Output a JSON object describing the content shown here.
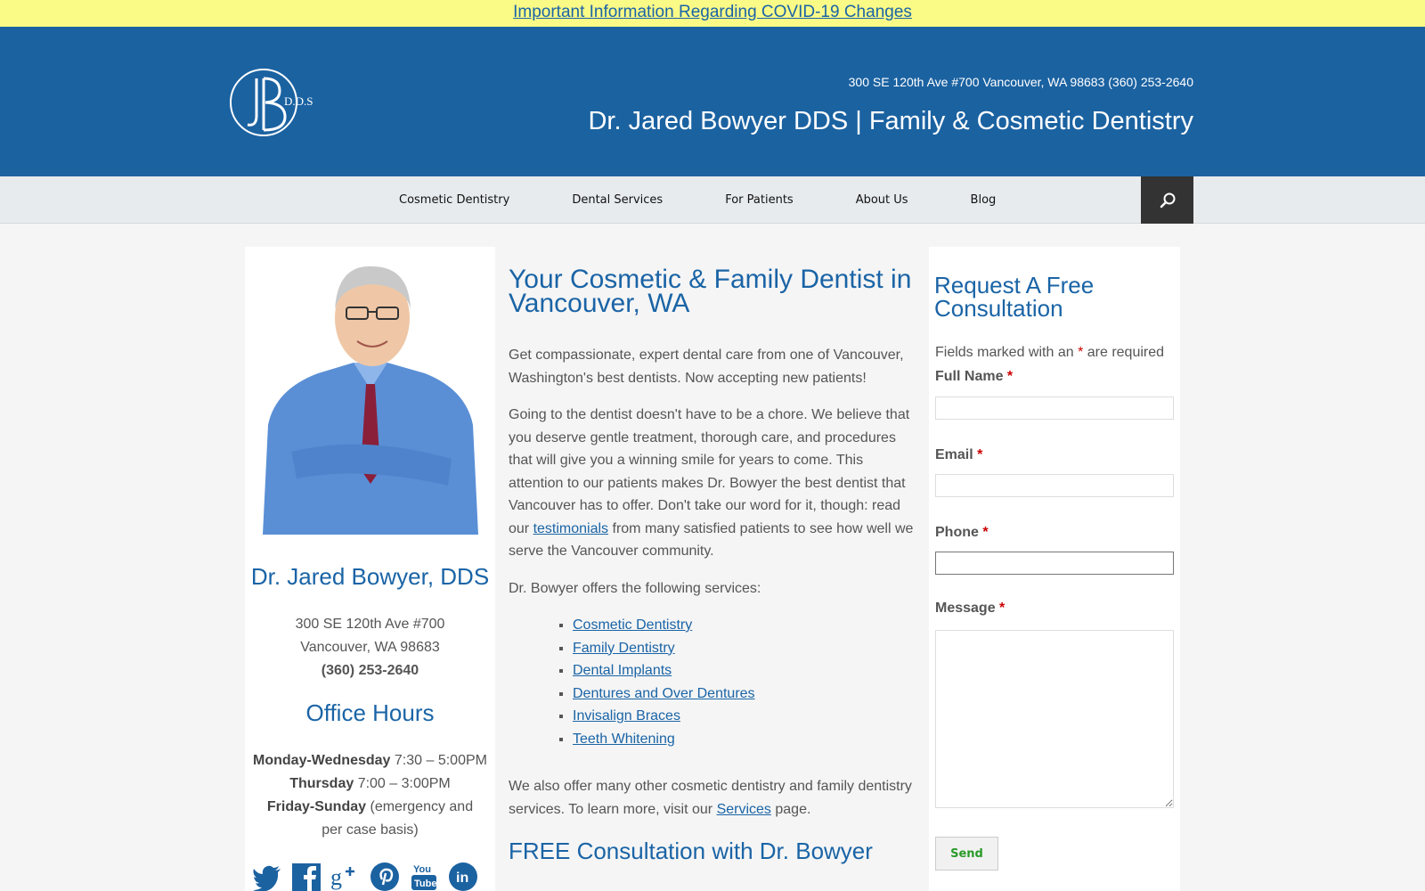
{
  "banner": {
    "text": "Important Information Regarding COVID-19 Changes"
  },
  "header": {
    "address_phone": "300 SE 120th Ave #700 Vancouver, WA 98683 (360) 253-2640",
    "site_title": "Dr. Jared Bowyer DDS | Family & Cosmetic Dentistry",
    "logo_text": "D.D.S"
  },
  "nav": {
    "items": [
      {
        "label": "Cosmetic Dentistry"
      },
      {
        "label": "Dental Services"
      },
      {
        "label": "For Patients"
      },
      {
        "label": "About Us"
      },
      {
        "label": "Blog"
      }
    ],
    "search_icon": "search-icon"
  },
  "sidebar": {
    "doctor_name": "Dr. Jared Bowyer, DDS",
    "address_line1": "300 SE 120th Ave #700",
    "address_line2": "Vancouver, WA 98683",
    "phone": "(360) 253-2640",
    "hours_title": "Office Hours",
    "hours": [
      {
        "day": "Monday-Wednesday",
        "time": "7:30 – 5:00PM"
      },
      {
        "day": "Thursday",
        "time": "7:00 – 3:00PM"
      },
      {
        "day": "Friday-Sunday",
        "time": "(emergency and per case basis)"
      }
    ],
    "social": [
      "twitter-icon",
      "facebook-icon",
      "google-plus-icon",
      "pinterest-icon",
      "youtube-icon",
      "linkedin-icon"
    ],
    "youtube_text_top": "You",
    "youtube_text_bottom": "Tube",
    "linkedin_text": "in"
  },
  "main": {
    "heading": "Your Cosmetic & Family Dentist in Vancouver, WA",
    "intro": "Get compassionate, expert dental care from one of Vancouver, Washington's best dentists. Now accepting new patients!",
    "para2_before": "Going to the dentist doesn't have to be a chore. We believe that you deserve gentle treatment, thorough care, and procedures that will give you a winning smile for years to come. This attention to our patients makes Dr. Bowyer the best dentist that Vancouver has to offer. Don't take our word for it, though: read our ",
    "para2_link": "testimonials",
    "para2_after": " from many satisfied patients to see how well we serve the Vancouver community.",
    "services_intro": "Dr. Bowyer offers the following services:",
    "services": [
      "Cosmetic Dentistry",
      "Family Dentistry",
      "Dental Implants",
      "Dentures and Over Dentures",
      "Invisalign Braces",
      "Teeth Whitening"
    ],
    "outro_before": "We also offer many other cosmetic dentistry and family dentistry services. To learn more, visit our ",
    "outro_link": "Services",
    "outro_after": " page.",
    "subheading": "FREE Consultation with Dr. Bowyer"
  },
  "form": {
    "title": "Request A Free Consultation",
    "required_note_before": "Fields marked with an ",
    "required_star": "*",
    "required_note_after": " are required",
    "full_name_label": "Full Name",
    "email_label": "Email",
    "phone_label": "Phone",
    "message_label": "Message",
    "send_label": "Send"
  },
  "colors": {
    "brand_blue": "#1b62a1",
    "link_blue": "#1a64a6",
    "banner_yellow": "#fafa87",
    "required_red": "#cc0000"
  }
}
